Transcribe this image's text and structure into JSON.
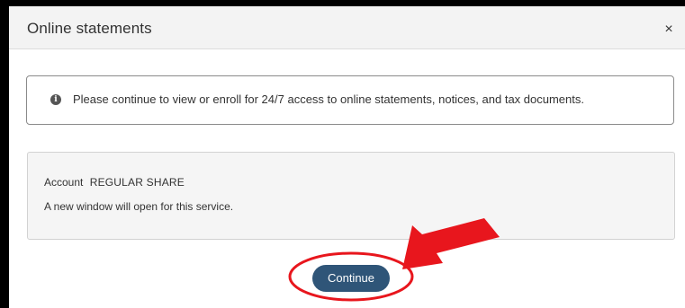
{
  "modal": {
    "title": "Online statements",
    "close_glyph": "×"
  },
  "info": {
    "icon": "info-icon",
    "message": "Please continue to view or enroll for 24/7 access to online statements, notices, and tax documents."
  },
  "account": {
    "label": "Account",
    "value": "REGULAR SHARE",
    "note": "A new window will open for this service."
  },
  "actions": {
    "continue_label": "Continue"
  },
  "colors": {
    "primary_button": "#2f5578",
    "annotation_red": "#e8161d"
  }
}
